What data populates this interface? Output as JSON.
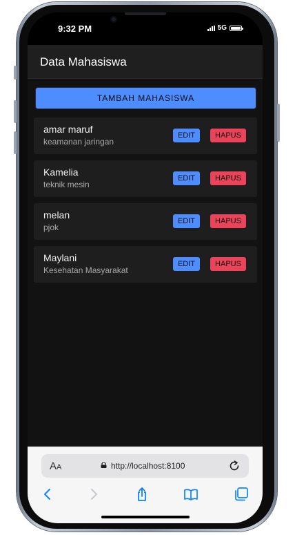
{
  "status_bar": {
    "time": "9:32 PM",
    "network": "5G"
  },
  "header": {
    "title": "Data Mahasiswa"
  },
  "add_button": {
    "label": "TAMBAH MAHASISWA"
  },
  "students": [
    {
      "name": "amar maruf",
      "major": "keamanan jaringan",
      "edit_label": "EDIT",
      "delete_label": "HAPUS"
    },
    {
      "name": "Kamelia",
      "major": "teknik mesin",
      "edit_label": "EDIT",
      "delete_label": "HAPUS"
    },
    {
      "name": "melan",
      "major": "pjok",
      "edit_label": "EDIT",
      "delete_label": "HAPUS"
    },
    {
      "name": "Maylani",
      "major": "Kesehatan Masyarakat",
      "edit_label": "EDIT",
      "delete_label": "HAPUS"
    }
  ],
  "browser": {
    "text_size_label": "AA",
    "url": "http://localhost:8100",
    "icons": [
      "text-size-icon",
      "lock-icon",
      "reload-icon",
      "back-icon",
      "forward-icon",
      "share-icon",
      "bookmarks-icon",
      "tabs-icon"
    ]
  },
  "colors": {
    "primary": "#4d8dff",
    "danger": "#eb445a",
    "background": "#121212",
    "card": "#1e1e1e",
    "header": "#1f1f1f",
    "browser_accent": "#0a84ff"
  }
}
